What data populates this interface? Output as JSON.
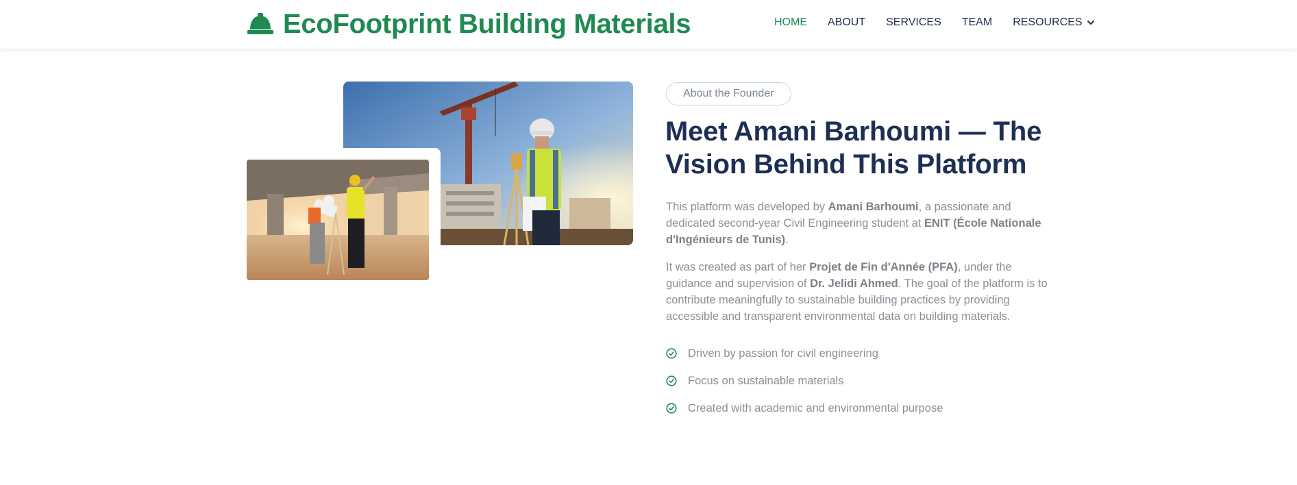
{
  "header": {
    "brand_icon": "hard-hat-icon",
    "brand_name": "EcoFootprint Building Materials",
    "nav": [
      {
        "label": "HOME",
        "active": true
      },
      {
        "label": "ABOUT",
        "active": false
      },
      {
        "label": "SERVICES",
        "active": false
      },
      {
        "label": "TEAM",
        "active": false
      },
      {
        "label": "RESOURCES",
        "active": false,
        "icon": "chevron-down-icon"
      }
    ]
  },
  "images": {
    "back": "construction-worker-surveying-crane-photo",
    "front": "engineers-under-bridge-surveying-photo"
  },
  "about": {
    "badge": "About the Founder",
    "title": "Meet Amani Barhoumi — The Vision Behind This Platform",
    "p1": {
      "t1": "This platform was developed by ",
      "b1": "Amani Barhoumi",
      "t2": ", a passionate and dedicated second-year Civil Engineering student at ",
      "b2": "ENIT (École Nationale d'Ingénieurs de Tunis)",
      "t3": "."
    },
    "p2": {
      "t1": "It was created as part of her ",
      "b1": "Projet de Fin d'Année (PFA)",
      "t2": ", under the guidance and supervision of ",
      "b2": "Dr. Jelidi Ahmed",
      "t3": ". The goal of the platform is to contribute meaningfully to sustainable building practices by providing accessible and transparent environmental data on building materials."
    },
    "checklist": [
      "Driven by passion for civil engineering",
      "Focus on sustainable materials",
      "Created with academic and environmental purpose"
    ],
    "check_icon": "check-circle-icon"
  },
  "colors": {
    "brand_green": "#1e8a50",
    "navy": "#1d2f55",
    "text_gray": "#8a8f98"
  }
}
